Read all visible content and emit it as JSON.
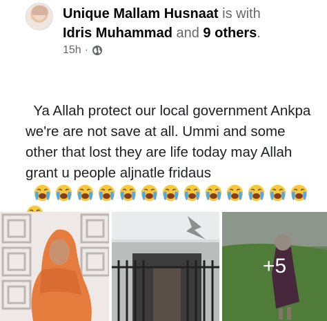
{
  "post": {
    "author": "Unique Mallam Husnaat",
    "with_text": "is with",
    "tagged_person": "Idris Muhammad",
    "and_text": "and",
    "others": "9 others",
    "period": ".",
    "time": "15h",
    "separator": "·",
    "privacy_icon": "globe-icon",
    "text": "Ya Allah protect our local government Ankpa we're are not save at all. Ummi and some other that lost they are life today may Allah grant u people aljnatle fridaus",
    "emoji_name": "loudly-crying-face",
    "emoji_count": 14
  },
  "photos": {
    "more_label": "+5"
  },
  "colors": {
    "primary_text": "#050505",
    "secondary_text": "#65676b"
  }
}
